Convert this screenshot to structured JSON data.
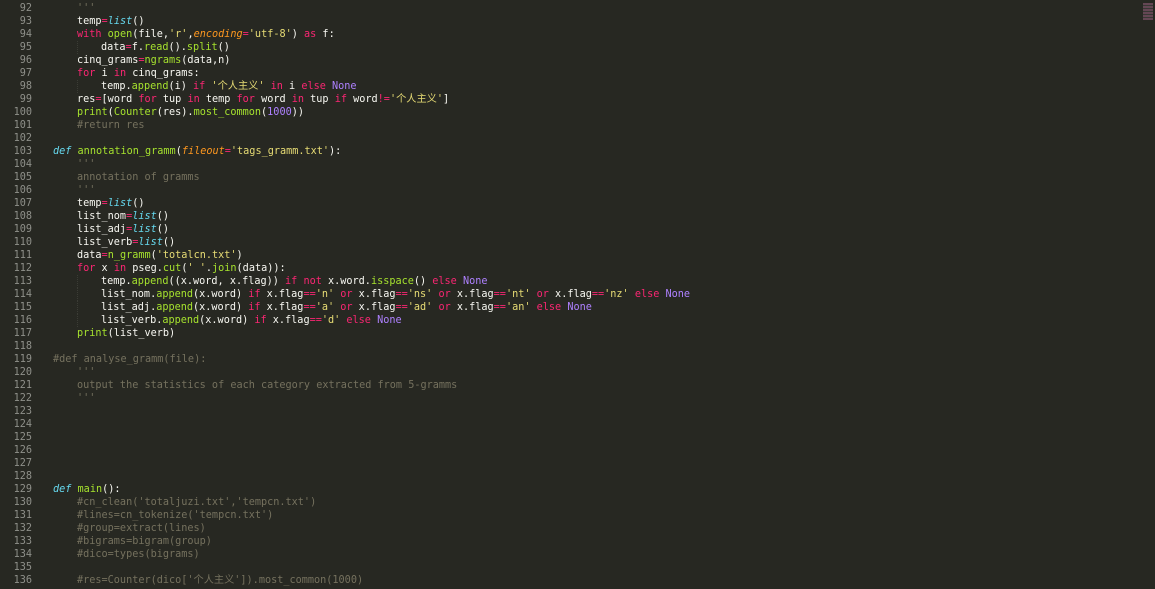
{
  "editor": {
    "theme_colors": {
      "background": "#272822",
      "gutter_text": "#8f908a",
      "default": "#f8f8f2",
      "keyword": "#f92672",
      "function": "#a6e22e",
      "builtin": "#66d9ef",
      "string": "#e6db74",
      "comment": "#75715e",
      "number": "#ae81ff",
      "param": "#fd971f"
    },
    "lines": [
      {
        "n": "92",
        "indent": 1,
        "tokens": [
          [
            "cm",
            "'''"
          ]
        ]
      },
      {
        "n": "93",
        "indent": 1,
        "tokens": [
          [
            "dft",
            "temp"
          ],
          [
            "op",
            "="
          ],
          [
            "bi",
            "list"
          ],
          [
            "dft",
            "()"
          ]
        ]
      },
      {
        "n": "94",
        "indent": 1,
        "tokens": [
          [
            "kw",
            "with "
          ],
          [
            "fn",
            "open"
          ],
          [
            "dft",
            "(file,"
          ],
          [
            "str",
            "'r'"
          ],
          [
            "dft",
            ","
          ],
          [
            "prm",
            "encoding"
          ],
          [
            "op",
            "="
          ],
          [
            "str",
            "'utf-8'"
          ],
          [
            "dft",
            ") "
          ],
          [
            "kw",
            "as"
          ],
          [
            "dft",
            " f:"
          ]
        ]
      },
      {
        "n": "95",
        "indent": 2,
        "tokens": [
          [
            "dft",
            "data"
          ],
          [
            "op",
            "="
          ],
          [
            "dft",
            "f."
          ],
          [
            "fn",
            "read"
          ],
          [
            "dft",
            "()."
          ],
          [
            "fn",
            "split"
          ],
          [
            "dft",
            "()"
          ]
        ]
      },
      {
        "n": "96",
        "indent": 1,
        "tokens": [
          [
            "dft",
            "cinq_grams"
          ],
          [
            "op",
            "="
          ],
          [
            "fn",
            "ngrams"
          ],
          [
            "dft",
            "(data,n)"
          ]
        ]
      },
      {
        "n": "97",
        "indent": 1,
        "tokens": [
          [
            "kw",
            "for"
          ],
          [
            "dft",
            " i "
          ],
          [
            "kw",
            "in"
          ],
          [
            "dft",
            " cinq_grams:"
          ]
        ]
      },
      {
        "n": "98",
        "indent": 2,
        "tokens": [
          [
            "dft",
            "temp."
          ],
          [
            "fn",
            "append"
          ],
          [
            "dft",
            "(i) "
          ],
          [
            "kw",
            "if"
          ],
          [
            "dft",
            " "
          ],
          [
            "str",
            "'个人主义'"
          ],
          [
            "dft",
            " "
          ],
          [
            "kw",
            "in"
          ],
          [
            "dft",
            " i "
          ],
          [
            "kw",
            "else"
          ],
          [
            "dft",
            " "
          ],
          [
            "cst",
            "None"
          ]
        ]
      },
      {
        "n": "99",
        "indent": 1,
        "tokens": [
          [
            "dft",
            "res"
          ],
          [
            "op",
            "="
          ],
          [
            "dft",
            "[word "
          ],
          [
            "kw",
            "for"
          ],
          [
            "dft",
            " tup "
          ],
          [
            "kw",
            "in"
          ],
          [
            "dft",
            " temp "
          ],
          [
            "kw",
            "for"
          ],
          [
            "dft",
            " word "
          ],
          [
            "kw",
            "in"
          ],
          [
            "dft",
            " tup "
          ],
          [
            "kw",
            "if"
          ],
          [
            "dft",
            " word"
          ],
          [
            "op",
            "!="
          ],
          [
            "str",
            "'个人主义'"
          ],
          [
            "dft",
            "]"
          ]
        ]
      },
      {
        "n": "100",
        "indent": 1,
        "tokens": [
          [
            "fn",
            "print"
          ],
          [
            "dft",
            "("
          ],
          [
            "fn",
            "Counter"
          ],
          [
            "dft",
            "(res)."
          ],
          [
            "fn",
            "most_common"
          ],
          [
            "dft",
            "("
          ],
          [
            "num",
            "1000"
          ],
          [
            "dft",
            "))"
          ]
        ]
      },
      {
        "n": "101",
        "indent": 1,
        "tokens": [
          [
            "cm",
            "#return res"
          ]
        ]
      },
      {
        "n": "102",
        "indent": 0,
        "tokens": []
      },
      {
        "n": "103",
        "indent": 0,
        "tokens": [
          [
            "def",
            "def"
          ],
          [
            "dft",
            " "
          ],
          [
            "fn",
            "annotation_gramm"
          ],
          [
            "dft",
            "("
          ],
          [
            "prm",
            "fileout"
          ],
          [
            "op",
            "="
          ],
          [
            "str",
            "'tags_gramm.txt'"
          ],
          [
            "dft",
            "):"
          ]
        ]
      },
      {
        "n": "104",
        "indent": 1,
        "tokens": [
          [
            "cm",
            "'''"
          ]
        ]
      },
      {
        "n": "105",
        "indent": 1,
        "tokens": [
          [
            "cm",
            "annotation of gramms"
          ]
        ]
      },
      {
        "n": "106",
        "indent": 1,
        "tokens": [
          [
            "cm",
            "'''"
          ]
        ]
      },
      {
        "n": "107",
        "indent": 1,
        "tokens": [
          [
            "dft",
            "temp"
          ],
          [
            "op",
            "="
          ],
          [
            "bi",
            "list"
          ],
          [
            "dft",
            "()"
          ]
        ]
      },
      {
        "n": "108",
        "indent": 1,
        "tokens": [
          [
            "dft",
            "list_nom"
          ],
          [
            "op",
            "="
          ],
          [
            "bi",
            "list"
          ],
          [
            "dft",
            "()"
          ]
        ]
      },
      {
        "n": "109",
        "indent": 1,
        "tokens": [
          [
            "dft",
            "list_adj"
          ],
          [
            "op",
            "="
          ],
          [
            "bi",
            "list"
          ],
          [
            "dft",
            "()"
          ]
        ]
      },
      {
        "n": "110",
        "indent": 1,
        "tokens": [
          [
            "dft",
            "list_verb"
          ],
          [
            "op",
            "="
          ],
          [
            "bi",
            "list"
          ],
          [
            "dft",
            "()"
          ]
        ]
      },
      {
        "n": "111",
        "indent": 1,
        "tokens": [
          [
            "dft",
            "data"
          ],
          [
            "op",
            "="
          ],
          [
            "fn",
            "n_gramm"
          ],
          [
            "dft",
            "("
          ],
          [
            "str",
            "'totalcn.txt'"
          ],
          [
            "dft",
            ")"
          ]
        ]
      },
      {
        "n": "112",
        "indent": 1,
        "tokens": [
          [
            "kw",
            "for"
          ],
          [
            "dft",
            " x "
          ],
          [
            "kw",
            "in"
          ],
          [
            "dft",
            " pseg."
          ],
          [
            "fn",
            "cut"
          ],
          [
            "dft",
            "("
          ],
          [
            "str",
            "' '"
          ],
          [
            "dft",
            "."
          ],
          [
            "fn",
            "join"
          ],
          [
            "dft",
            "(data)):"
          ]
        ]
      },
      {
        "n": "113",
        "indent": 2,
        "tokens": [
          [
            "dft",
            "temp."
          ],
          [
            "fn",
            "append"
          ],
          [
            "dft",
            "((x.word, x.flag)) "
          ],
          [
            "kw",
            "if"
          ],
          [
            "dft",
            " "
          ],
          [
            "kw",
            "not"
          ],
          [
            "dft",
            " x.word."
          ],
          [
            "fn",
            "isspace"
          ],
          [
            "dft",
            "() "
          ],
          [
            "kw",
            "else"
          ],
          [
            "dft",
            " "
          ],
          [
            "cst",
            "None"
          ]
        ]
      },
      {
        "n": "114",
        "indent": 2,
        "tokens": [
          [
            "dft",
            "list_nom."
          ],
          [
            "fn",
            "append"
          ],
          [
            "dft",
            "(x.word) "
          ],
          [
            "kw",
            "if"
          ],
          [
            "dft",
            " x.flag"
          ],
          [
            "op",
            "=="
          ],
          [
            "str",
            "'n'"
          ],
          [
            "dft",
            " "
          ],
          [
            "kw",
            "or"
          ],
          [
            "dft",
            " x.flag"
          ],
          [
            "op",
            "=="
          ],
          [
            "str",
            "'ns'"
          ],
          [
            "dft",
            " "
          ],
          [
            "kw",
            "or"
          ],
          [
            "dft",
            " x.flag"
          ],
          [
            "op",
            "=="
          ],
          [
            "str",
            "'nt'"
          ],
          [
            "dft",
            " "
          ],
          [
            "kw",
            "or"
          ],
          [
            "dft",
            " x.flag"
          ],
          [
            "op",
            "=="
          ],
          [
            "str",
            "'nz'"
          ],
          [
            "dft",
            " "
          ],
          [
            "kw",
            "else"
          ],
          [
            "dft",
            " "
          ],
          [
            "cst",
            "None"
          ]
        ]
      },
      {
        "n": "115",
        "indent": 2,
        "tokens": [
          [
            "dft",
            "list_adj."
          ],
          [
            "fn",
            "append"
          ],
          [
            "dft",
            "(x.word) "
          ],
          [
            "kw",
            "if"
          ],
          [
            "dft",
            " x.flag"
          ],
          [
            "op",
            "=="
          ],
          [
            "str",
            "'a'"
          ],
          [
            "dft",
            " "
          ],
          [
            "kw",
            "or"
          ],
          [
            "dft",
            " x.flag"
          ],
          [
            "op",
            "=="
          ],
          [
            "str",
            "'ad'"
          ],
          [
            "dft",
            " "
          ],
          [
            "kw",
            "or"
          ],
          [
            "dft",
            " x.flag"
          ],
          [
            "op",
            "=="
          ],
          [
            "str",
            "'an'"
          ],
          [
            "dft",
            " "
          ],
          [
            "kw",
            "else"
          ],
          [
            "dft",
            " "
          ],
          [
            "cst",
            "None"
          ]
        ]
      },
      {
        "n": "116",
        "indent": 2,
        "tokens": [
          [
            "dft",
            "list_verb."
          ],
          [
            "fn",
            "append"
          ],
          [
            "dft",
            "(x.word) "
          ],
          [
            "kw",
            "if"
          ],
          [
            "dft",
            " x.flag"
          ],
          [
            "op",
            "=="
          ],
          [
            "str",
            "'d'"
          ],
          [
            "dft",
            " "
          ],
          [
            "kw",
            "else"
          ],
          [
            "dft",
            " "
          ],
          [
            "cst",
            "None"
          ]
        ]
      },
      {
        "n": "117",
        "indent": 1,
        "tokens": [
          [
            "fn",
            "print"
          ],
          [
            "dft",
            "(list_verb)"
          ]
        ]
      },
      {
        "n": "118",
        "indent": 0,
        "tokens": []
      },
      {
        "n": "119",
        "indent": 0,
        "tokens": [
          [
            "cm",
            "#def analyse_gramm(file):"
          ]
        ]
      },
      {
        "n": "120",
        "indent": 1,
        "tokens": [
          [
            "cm",
            "'''"
          ]
        ]
      },
      {
        "n": "121",
        "indent": 1,
        "tokens": [
          [
            "cm",
            "output the statistics of each category extracted from 5-gramms"
          ]
        ]
      },
      {
        "n": "122",
        "indent": 1,
        "tokens": [
          [
            "cm",
            "'''"
          ]
        ]
      },
      {
        "n": "123",
        "indent": 0,
        "tokens": []
      },
      {
        "n": "124",
        "indent": 0,
        "tokens": []
      },
      {
        "n": "125",
        "indent": 0,
        "tokens": []
      },
      {
        "n": "126",
        "indent": 0,
        "tokens": []
      },
      {
        "n": "127",
        "indent": 0,
        "tokens": []
      },
      {
        "n": "128",
        "indent": 0,
        "tokens": []
      },
      {
        "n": "129",
        "indent": 0,
        "tokens": [
          [
            "def",
            "def"
          ],
          [
            "dft",
            " "
          ],
          [
            "fn",
            "main"
          ],
          [
            "dft",
            "():"
          ]
        ]
      },
      {
        "n": "130",
        "indent": 1,
        "tokens": [
          [
            "cm",
            "#cn_clean('totaljuzi.txt','tempcn.txt')"
          ]
        ]
      },
      {
        "n": "131",
        "indent": 1,
        "tokens": [
          [
            "cm",
            "#lines=cn_tokenize('tempcn.txt')"
          ]
        ]
      },
      {
        "n": "132",
        "indent": 1,
        "tokens": [
          [
            "cm",
            "#group=extract(lines)"
          ]
        ]
      },
      {
        "n": "133",
        "indent": 1,
        "tokens": [
          [
            "cm",
            "#bigrams=bigram(group)"
          ]
        ]
      },
      {
        "n": "134",
        "indent": 1,
        "tokens": [
          [
            "cm",
            "#dico=types(bigrams)"
          ]
        ]
      },
      {
        "n": "135",
        "indent": 0,
        "tokens": []
      },
      {
        "n": "136",
        "indent": 1,
        "tokens": [
          [
            "cm",
            "#res=Counter(dico['个人主义']).most_common(1000)"
          ]
        ]
      }
    ]
  }
}
